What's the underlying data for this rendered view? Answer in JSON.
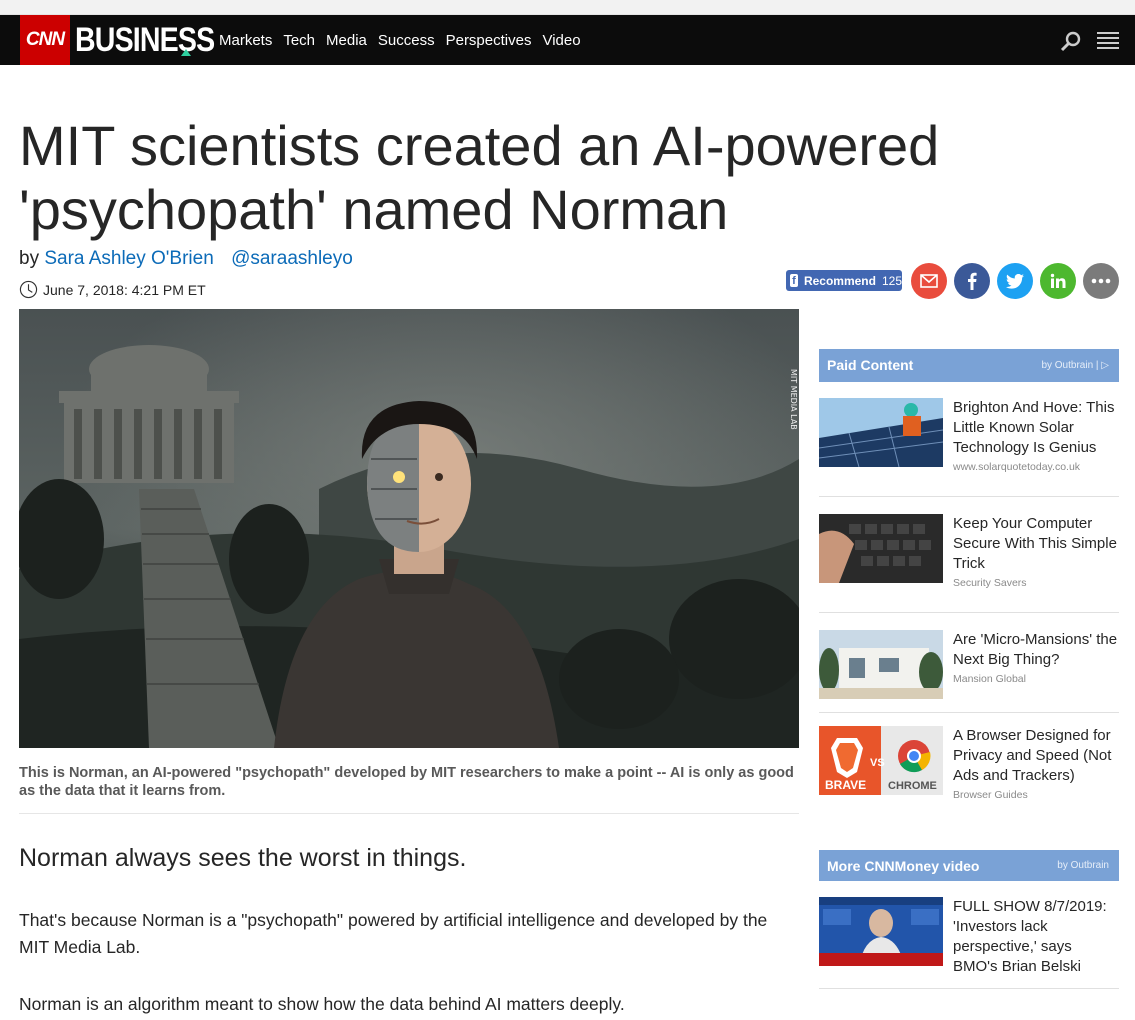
{
  "nav": {
    "cnn_logo": "CNN",
    "business_logo": "BUSINESS",
    "links": [
      "Markets",
      "Tech",
      "Media",
      "Success",
      "Perspectives",
      "Video"
    ],
    "search_icon": "search-icon",
    "menu_icon": "hamburger-menu-icon"
  },
  "article": {
    "headline": "MIT scientists created an AI-powered 'psychopath' named Norman",
    "by_prefix": "by",
    "author": "Sara Ashley O'Brien",
    "author_twitter": "@saraashleyo",
    "timestamp": "June 7, 2018: 4:21 PM ET",
    "image_credit": "MIT MEDIA LAB",
    "caption": "This is Norman, an AI-powered \"psychopath\" developed by MIT researchers to make a point -- AI is only as good as the data that it learns from.",
    "lede": "Norman always sees the worst in things.",
    "paragraphs": [
      "That's because Norman is a \"psychopath\" powered by artificial intelligence and developed by the MIT Media Lab.",
      "Norman is an algorithm meant to show how the data behind AI matters deeply."
    ]
  },
  "share": {
    "recommend_label": "Recommend",
    "recommend_count": "125",
    "buttons": [
      "email-icon",
      "facebook-icon",
      "twitter-icon",
      "linkedin-icon",
      "more-icon"
    ],
    "colors": {
      "email": "#e94c3d",
      "facebook": "#3b5998",
      "twitter": "#1da1f2",
      "linkedin": "#4db82f",
      "more": "#7b7b7b"
    }
  },
  "sidebar": {
    "paid": {
      "title": "Paid Content",
      "by": "by Outbrain",
      "items": [
        {
          "title": "Brighton And Hove: This Little Known Solar Technology Is Genius",
          "source": "www.solarquotetoday.co.uk"
        },
        {
          "title": "Keep Your Computer Secure With This Simple Trick",
          "source": "Security Savers"
        },
        {
          "title": "Are 'Micro-Mansions' the Next Big Thing?",
          "source": "Mansion Global"
        },
        {
          "title": "A Browser Designed for Privacy and Speed (Not Ads and Trackers)",
          "source": "Browser Guides"
        }
      ]
    },
    "video": {
      "title": "More CNNMoney video",
      "by": "by Outbrain",
      "items": [
        {
          "title": "FULL SHOW 8/7/2019: 'Investors lack perspective,' says BMO's Brian Belski"
        }
      ]
    },
    "thumb_labels": {
      "brave": "BRAVE",
      "vs": "VS",
      "chrome": "CHROME"
    }
  }
}
